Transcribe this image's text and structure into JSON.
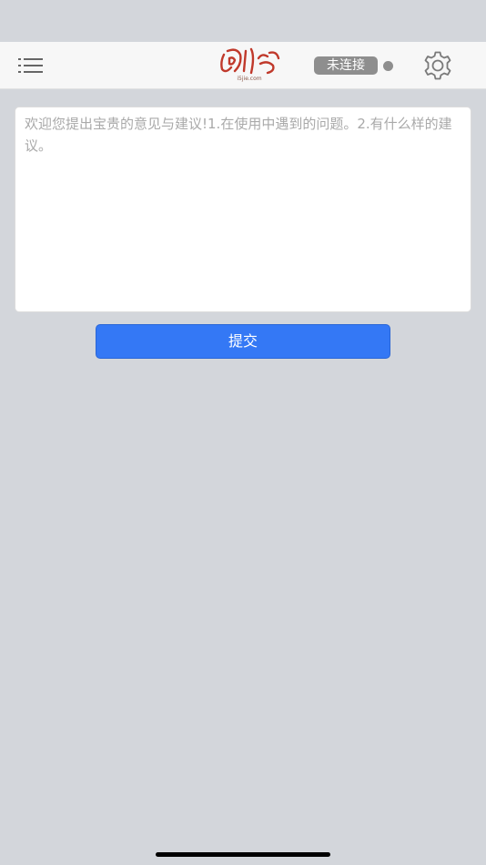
{
  "header": {
    "logo_domain": "i5jie.com",
    "connection_status": "未连接",
    "menu_icon": "menu-icon",
    "settings_icon": "gear-icon"
  },
  "feedback": {
    "placeholder": "欢迎您提出宝贵的意见与建议!1.在使用中遇到的问题。2.有什么样的建议。",
    "value": ""
  },
  "actions": {
    "submit_label": "提交"
  },
  "colors": {
    "background": "#d3d6db",
    "nav_background": "#f7f7f7",
    "primary": "#3478f5",
    "status_gray": "#8e8e8e",
    "logo_red": "#c0392b"
  }
}
